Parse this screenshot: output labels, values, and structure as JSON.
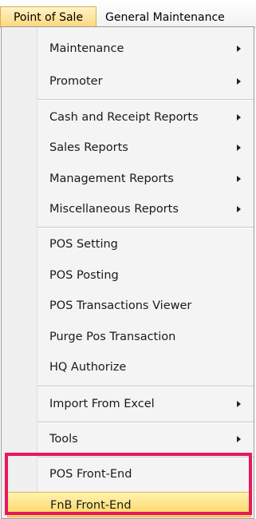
{
  "menubar": {
    "point_of_sale": "Point of Sale",
    "general_maintenance": "General Maintenance"
  },
  "menu": {
    "maintenance": "Maintenance",
    "promoter": "Promoter",
    "cash_receipt_reports": "Cash and Receipt Reports",
    "sales_reports": "Sales Reports",
    "management_reports": "Management Reports",
    "misc_reports": "Miscellaneous Reports",
    "pos_setting": "POS Setting",
    "pos_posting": "POS Posting",
    "pos_transactions_viewer": "POS Transactions Viewer",
    "purge_pos_transaction": "Purge Pos Transaction",
    "hq_authorize": "HQ Authorize",
    "import_from_excel": "Import From Excel",
    "tools": "Tools",
    "pos_front_end": "POS Front-End",
    "fnb_front_end": "FnB Front-End"
  },
  "colors": {
    "highlight_border": "#e8175d",
    "selected_bg": "#fbd55f"
  }
}
